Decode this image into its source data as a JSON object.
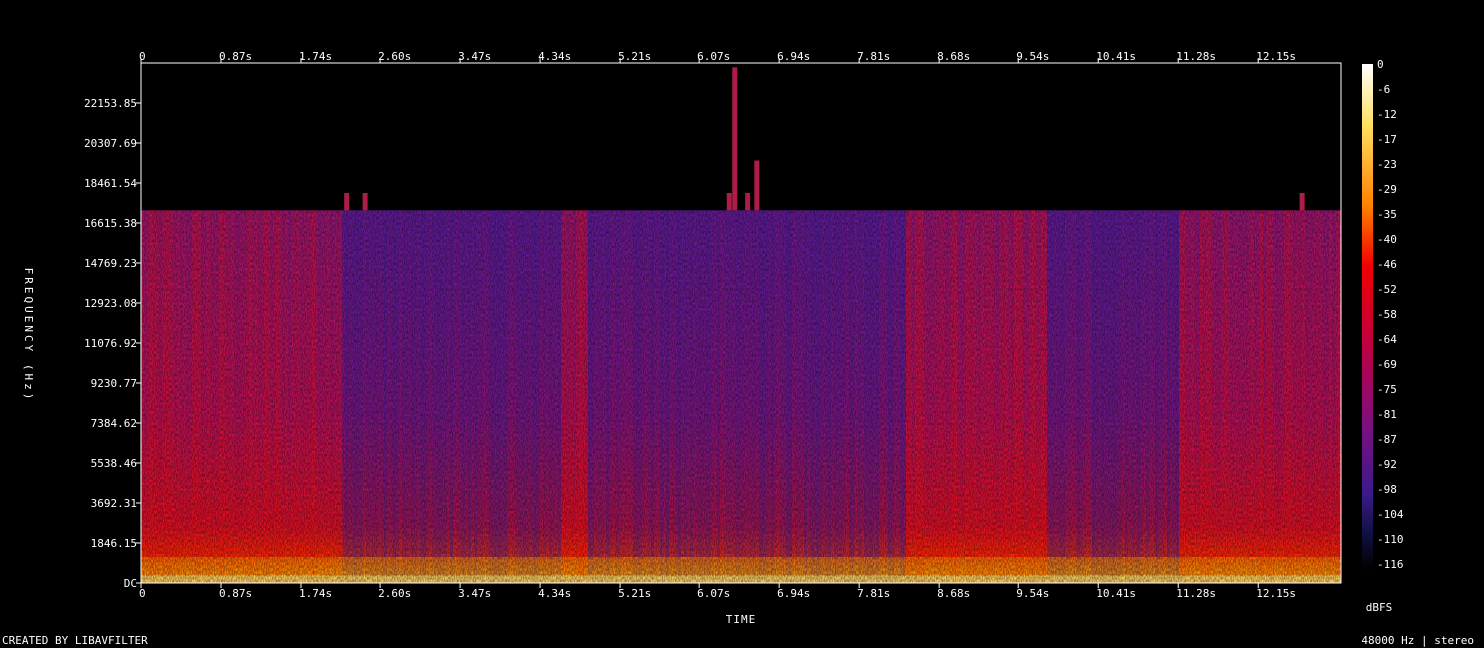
{
  "chart_data": {
    "type": "heatmap",
    "title": "",
    "xlabel": "TIME",
    "ylabel": "FREQUENCY (Hz)",
    "x_ticks": [
      {
        "value": 0,
        "label": "0"
      },
      {
        "value": 0.87,
        "label": "0.87s"
      },
      {
        "value": 1.74,
        "label": "1.74s"
      },
      {
        "value": 2.6,
        "label": "2.60s"
      },
      {
        "value": 3.47,
        "label": "3.47s"
      },
      {
        "value": 4.34,
        "label": "4.34s"
      },
      {
        "value": 5.21,
        "label": "5.21s"
      },
      {
        "value": 6.07,
        "label": "6.07s"
      },
      {
        "value": 6.94,
        "label": "6.94s"
      },
      {
        "value": 7.81,
        "label": "7.81s"
      },
      {
        "value": 8.68,
        "label": "8.68s"
      },
      {
        "value": 9.54,
        "label": "9.54s"
      },
      {
        "value": 10.41,
        "label": "10.41s"
      },
      {
        "value": 11.28,
        "label": "11.28s"
      },
      {
        "value": 12.15,
        "label": "12.15s"
      }
    ],
    "xlim": [
      0,
      13.05
    ],
    "y_ticks": [
      {
        "value": 0,
        "label": "DC"
      },
      {
        "value": 1846.15,
        "label": "1846.15"
      },
      {
        "value": 3692.31,
        "label": "3692.31"
      },
      {
        "value": 5538.46,
        "label": "5538.46"
      },
      {
        "value": 7384.62,
        "label": "7384.62"
      },
      {
        "value": 9230.77,
        "label": "9230.77"
      },
      {
        "value": 11076.92,
        "label": "11076.92"
      },
      {
        "value": 12923.08,
        "label": "12923.08"
      },
      {
        "value": 14769.23,
        "label": "14769.23"
      },
      {
        "value": 16615.38,
        "label": "16615.38"
      },
      {
        "value": 18461.54,
        "label": "18461.54"
      },
      {
        "value": 20307.69,
        "label": "20307.69"
      },
      {
        "value": 22153.85,
        "label": "22153.85"
      }
    ],
    "ylim": [
      0,
      24000
    ],
    "colorbar": {
      "label": "dBFS",
      "range": [
        -120,
        0
      ],
      "ticks": [
        "0",
        "-6",
        "-12",
        "-17",
        "-23",
        "-29",
        "-35",
        "-40",
        "-46",
        "-52",
        "-58",
        "-64",
        "-69",
        "-75",
        "-81",
        "-87",
        "-92",
        "-98",
        "-104",
        "-110",
        "-116"
      ],
      "colors": [
        "#ffffff",
        "#ffe060",
        "#ff8000",
        "#f00000",
        "#c00040",
        "#7a1080",
        "#3a1a8a",
        "#101040",
        "#000000"
      ]
    },
    "cutoff_hz": 17200,
    "legend": "none",
    "grid": false
  },
  "footer": {
    "created_by": "CREATED BY LIBAVFILTER",
    "audio_info": "48000 Hz | stereo"
  }
}
